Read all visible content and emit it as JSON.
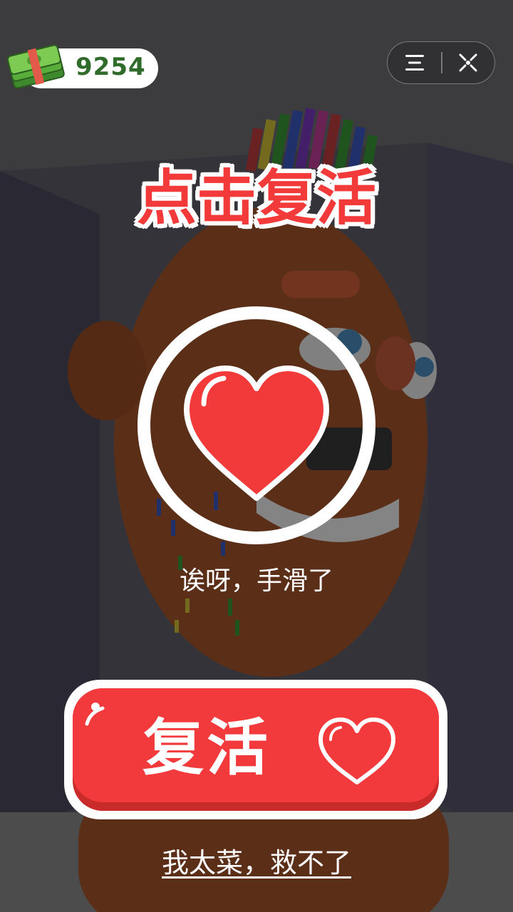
{
  "hud": {
    "cash_icon": "cash-stack-icon",
    "cash_value": "9254",
    "menu_icon": "menu-icon",
    "close_icon": "close-icon"
  },
  "dialog": {
    "title": "点击复活",
    "heart_icon": "heart-icon",
    "subtitle": "诶呀，手滑了",
    "revive_label": "复活",
    "revive_icon": "heart-outline-icon",
    "give_up_label": "我太菜，救不了"
  },
  "colors": {
    "accent_red": "#f23a3a",
    "cash_green": "#2f6b2a",
    "white": "#ffffff"
  }
}
